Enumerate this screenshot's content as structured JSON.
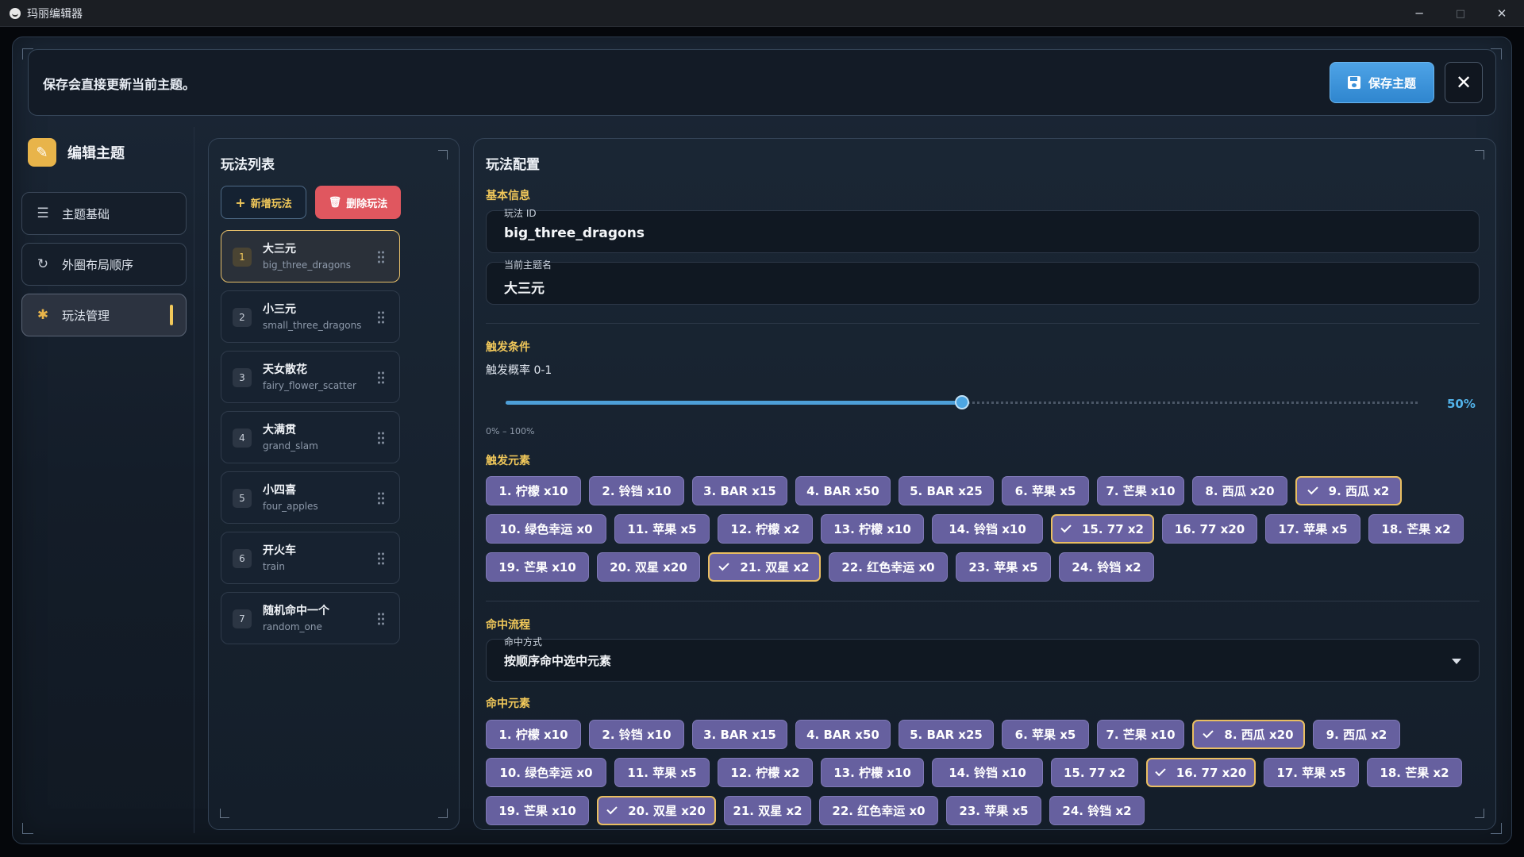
{
  "window": {
    "title": "玛丽编辑器",
    "minimize": "─",
    "maximize": "□",
    "close": "✕"
  },
  "topbar": {
    "message": "保存会直接更新当前主题。",
    "save_label": "保存主题",
    "close_glyph": "✕"
  },
  "sidebar": {
    "header": "编辑主题",
    "items": [
      {
        "label": "主题基础",
        "icon": "sliders-icon"
      },
      {
        "label": "外圈布局顺序",
        "icon": "refresh-icon"
      },
      {
        "label": "玩法管理",
        "icon": "puzzle-icon",
        "active": true
      }
    ]
  },
  "play_list": {
    "title": "玩法列表",
    "add_label": "新增玩法",
    "delete_label": "删除玩法",
    "items": [
      {
        "num": "1",
        "name": "大三元",
        "id": "big_three_dragons",
        "selected": true
      },
      {
        "num": "2",
        "name": "小三元",
        "id": "small_three_dragons"
      },
      {
        "num": "3",
        "name": "天女散花",
        "id": "fairy_flower_scatter"
      },
      {
        "num": "4",
        "name": "大满贯",
        "id": "grand_slam"
      },
      {
        "num": "5",
        "name": "小四喜",
        "id": "four_apples"
      },
      {
        "num": "6",
        "name": "开火车",
        "id": "train"
      },
      {
        "num": "7",
        "name": "随机命中一个",
        "id": "random_one"
      }
    ]
  },
  "config": {
    "title": "玩法配置",
    "basic_section": "基本信息",
    "id_label": "玩法 ID",
    "id_value": "big_three_dragons",
    "name_label": "当前主题名",
    "name_value": "大三元",
    "trigger_section": "触发条件",
    "prob_label": "触发概率 0-1",
    "prob_value": 0.5,
    "prob_display": "50%",
    "prob_range": "0% – 100%",
    "trigger_elements_label": "触发元素",
    "trigger_elements": [
      {
        "label": "1. 柠檬 x10"
      },
      {
        "label": "2. 铃铛 x10"
      },
      {
        "label": "3. BAR x15"
      },
      {
        "label": "4. BAR x50"
      },
      {
        "label": "5. BAR x25"
      },
      {
        "label": "6. 苹果 x5"
      },
      {
        "label": "7. 芒果 x10"
      },
      {
        "label": "8. 西瓜 x20"
      },
      {
        "label": "9. 西瓜 x2",
        "selected": true
      },
      {
        "label": "10. 绿色幸运 x0"
      },
      {
        "label": "11. 苹果 x5"
      },
      {
        "label": "12. 柠檬 x2"
      },
      {
        "label": "13. 柠檬 x10"
      },
      {
        "label": "14. 铃铛 x10"
      },
      {
        "label": "15. 77 x2",
        "selected": true
      },
      {
        "label": "16. 77 x20"
      },
      {
        "label": "17. 苹果 x5"
      },
      {
        "label": "18. 芒果 x2"
      },
      {
        "label": "19. 芒果 x10"
      },
      {
        "label": "20. 双星 x20"
      },
      {
        "label": "21. 双星 x2",
        "selected": true
      },
      {
        "label": "22. 红色幸运 x0"
      },
      {
        "label": "23. 苹果 x5"
      },
      {
        "label": "24. 铃铛 x2"
      }
    ],
    "hit_section": "命中流程",
    "hit_mode_label": "命中方式",
    "hit_mode_value": "按顺序命中选中元素",
    "hit_elements_label": "命中元素",
    "hit_elements": [
      {
        "label": "1. 柠檬 x10"
      },
      {
        "label": "2. 铃铛 x10"
      },
      {
        "label": "3. BAR x15"
      },
      {
        "label": "4. BAR x50"
      },
      {
        "label": "5. BAR x25"
      },
      {
        "label": "6. 苹果 x5"
      },
      {
        "label": "7. 芒果 x10"
      },
      {
        "label": "8. 西瓜 x20",
        "selected": true
      },
      {
        "label": "9. 西瓜 x2"
      },
      {
        "label": "10. 绿色幸运 x0"
      },
      {
        "label": "11. 苹果 x5"
      },
      {
        "label": "12. 柠檬 x2"
      },
      {
        "label": "13. 柠檬 x10"
      },
      {
        "label": "14. 铃铛 x10"
      },
      {
        "label": "15. 77 x2"
      },
      {
        "label": "16. 77 x20",
        "selected": true
      },
      {
        "label": "17. 苹果 x5"
      },
      {
        "label": "18. 芒果 x2"
      },
      {
        "label": "19. 芒果 x10"
      },
      {
        "label": "20. 双星 x20",
        "selected": true
      },
      {
        "label": "21. 双星 x2"
      },
      {
        "label": "22. 红色幸运 x0"
      },
      {
        "label": "23. 苹果 x5"
      },
      {
        "label": "24. 铃铛 x2"
      }
    ]
  }
}
